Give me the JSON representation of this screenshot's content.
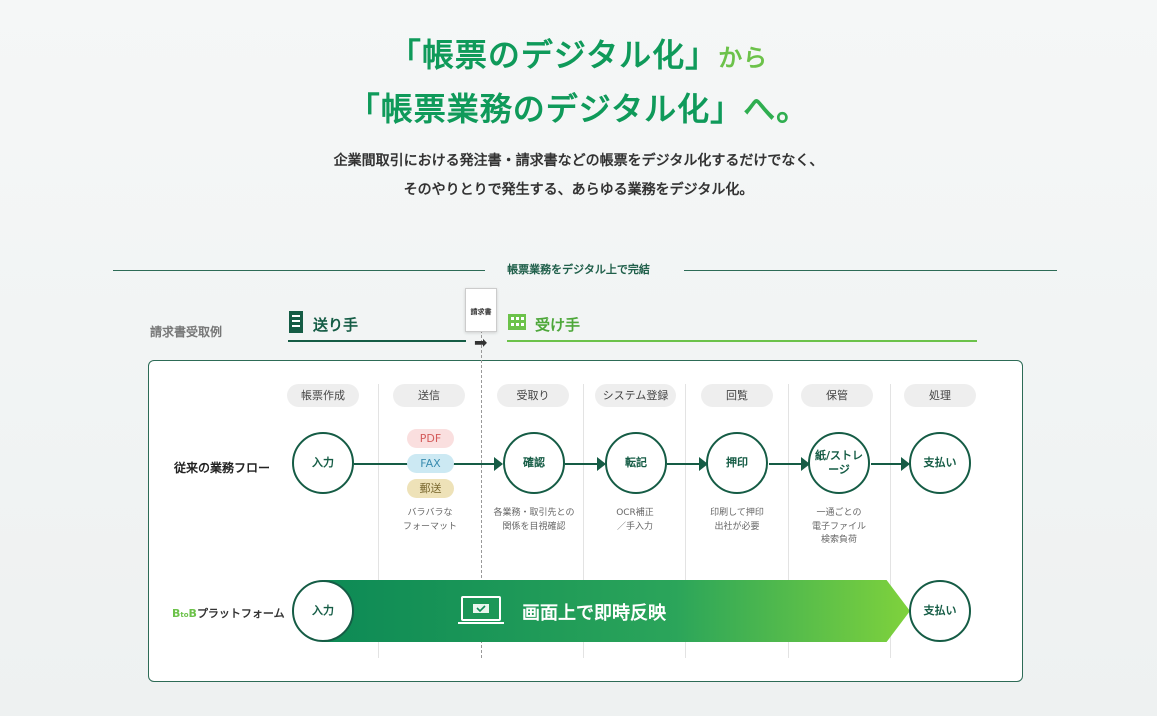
{
  "headline": {
    "line1_main": "「帳票のデジタル化」",
    "line1_tail": "から",
    "line2_main": "「帳票業務のデジタル化」",
    "line2_tail": "へ。"
  },
  "subtext": {
    "line1": "企業間取引における発注書・請求書などの帳票をデジタル化するだけでなく、",
    "line2": "そのやりとりで発生する、あらゆる業務をデジタル化。"
  },
  "section_label": "帳票業務をデジタル上で完結",
  "example_label": "請求書受取例",
  "sender_label": "送り手",
  "receiver_label": "受け手",
  "document_label": "請求書",
  "steps": [
    "帳票作成",
    "送信",
    "受取り",
    "システム登録",
    "回覧",
    "保管",
    "処理"
  ],
  "rows": {
    "traditional_label": "従来の業務フロー",
    "platform_label_prefix": "B",
    "platform_label_mid": "to",
    "platform_label_suffix": "B",
    "platform_label_rest": "プラットフォーム"
  },
  "traditional_nodes": [
    "入力",
    "確認",
    "転記",
    "押印",
    "紙/ストレージ",
    "支払い"
  ],
  "media": [
    "PDF",
    "FAX",
    "郵送"
  ],
  "notes": {
    "send": [
      "バラバラな",
      "フォーマット"
    ],
    "receive": [
      "各業務・取引先との",
      "関係を目視確認"
    ],
    "register": [
      "OCR補正",
      "／手入力"
    ],
    "review": [
      "印刷して押印",
      "出社が必要"
    ],
    "store": [
      "一通ごとの",
      "電子ファイル",
      "検索負荷"
    ]
  },
  "platform_nodes": {
    "start": "入力",
    "end": "支払い"
  },
  "banner_text": "画面上で即時反映",
  "colors": {
    "dark_green": "#155c45",
    "green": "#0f9a5a",
    "light_green": "#6cc24a"
  }
}
